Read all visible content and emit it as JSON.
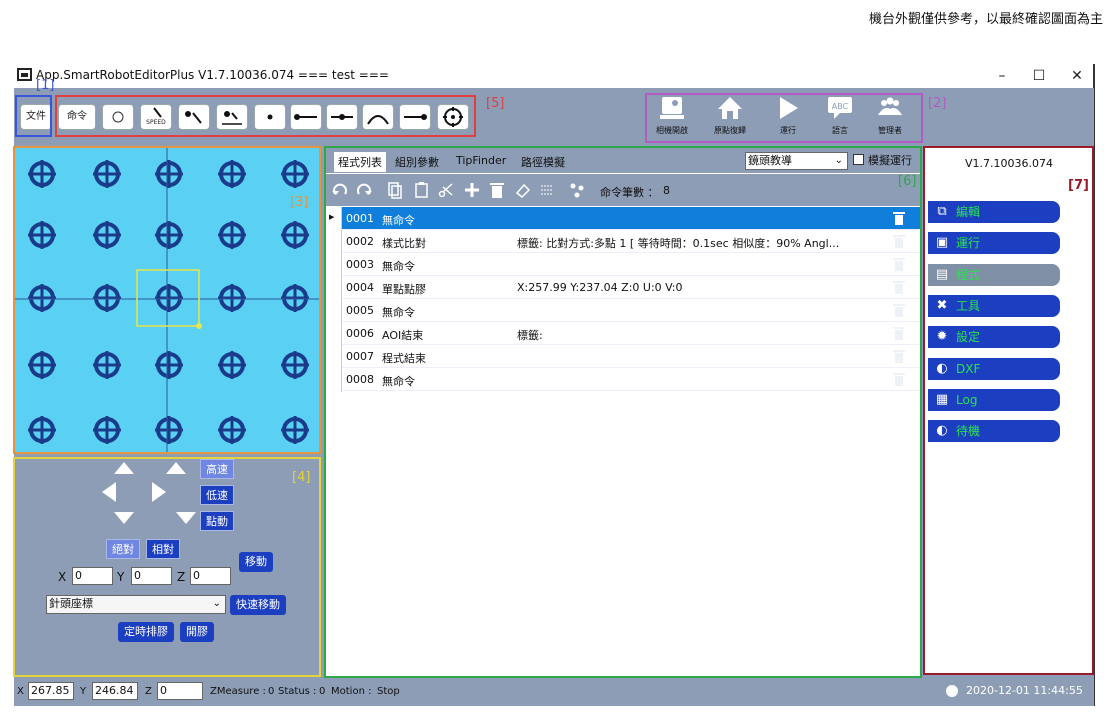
{
  "note": "機台外觀僅供參考，以最終確認圖面為主",
  "window": {
    "title": "App.SmartRobotEditorPlus V1.7.10036.074 === test ==="
  },
  "file_button": "文件",
  "command_button": "命令",
  "speed_label": "SPEED",
  "top_right": [
    {
      "icon": "camera-icon",
      "label": "相機開啟"
    },
    {
      "icon": "home-icon",
      "label": "原點復歸"
    },
    {
      "icon": "play-icon",
      "label": "運行"
    },
    {
      "icon": "abc-language-icon",
      "label": "語言"
    },
    {
      "icon": "users-icon",
      "label": "管理者"
    }
  ],
  "annotations": {
    "a1": "[1]",
    "a2": "[2]",
    "a3": "[3]",
    "a4": "[4]",
    "a5": "[5]",
    "a6": "[6]",
    "a7": "[7]"
  },
  "jog": {
    "high": "高速",
    "low": "低速",
    "step": "點動",
    "absolute": "絕對",
    "relative": "相對",
    "move": "移動",
    "x_label": "X",
    "y_label": "Y",
    "z_label": "Z",
    "x": "0",
    "y": "0",
    "z": "0",
    "coord_select": "針頭座標",
    "quick_move": "快速移動",
    "timed_dispense": "定時排膠",
    "open_glue": "開膠"
  },
  "tabs": [
    "程式列表",
    "組別參數",
    "TipFinder",
    "路徑模擬"
  ],
  "teach_select": "鏡頭教導",
  "simulate_label": "模擬運行",
  "command_count_label": "命令筆數 ：",
  "command_count": "8",
  "rows": [
    {
      "no": "0001",
      "cmd": "無命令",
      "detail": "",
      "selected": true
    },
    {
      "no": "0002",
      "cmd": "樣式比對",
      "detail": "標籤: 比對方式:多點 1 [ 等待時間：0.1sec 相似度：90% Angl...",
      "selected": false
    },
    {
      "no": "0003",
      "cmd": "無命令",
      "detail": "",
      "selected": false
    },
    {
      "no": "0004",
      "cmd": "單點點膠",
      "detail": "X:257.99 Y:237.04 Z:0 U:0 V:0",
      "selected": false
    },
    {
      "no": "0005",
      "cmd": "無命令",
      "detail": "",
      "selected": false
    },
    {
      "no": "0006",
      "cmd": "AOI結束",
      "detail": "標籤:",
      "selected": false
    },
    {
      "no": "0007",
      "cmd": "程式結束",
      "detail": "",
      "selected": false
    },
    {
      "no": "0008",
      "cmd": "無命令",
      "detail": "",
      "selected": false
    }
  ],
  "version": "V1.7.10036.074",
  "side_menu": [
    {
      "icon": "edit-icon",
      "label": "編輯",
      "active": true
    },
    {
      "icon": "run-icon",
      "label": "運行",
      "active": true
    },
    {
      "icon": "program-icon",
      "label": "程式",
      "active": false
    },
    {
      "icon": "tools-icon",
      "label": "工具",
      "active": true
    },
    {
      "icon": "settings-icon",
      "label": "設定",
      "active": true
    },
    {
      "icon": "dxf-icon",
      "label": "DXF",
      "active": true
    },
    {
      "icon": "log-icon",
      "label": "Log",
      "active": true
    },
    {
      "icon": "standby-icon",
      "label": "待機",
      "active": true
    }
  ],
  "status": {
    "x_label": "X",
    "x": "267.85",
    "y_label": "Y",
    "y": "246.84",
    "z_label": "Z",
    "z": "0",
    "zmeasure_label": "ZMeasure :",
    "zmeasure": "0",
    "status_label": "Status :",
    "status": "0",
    "motion_label": "Motion :",
    "motion": "Stop"
  },
  "datetime": "2020-12-01 11:44:55",
  "colors": {
    "accent": "#1c3fc2",
    "selected_row": "#0f7fdb",
    "menu_text": "#28e24e",
    "camera_bg": "#5ad0f2",
    "panel_bg": "#8d9db6"
  }
}
